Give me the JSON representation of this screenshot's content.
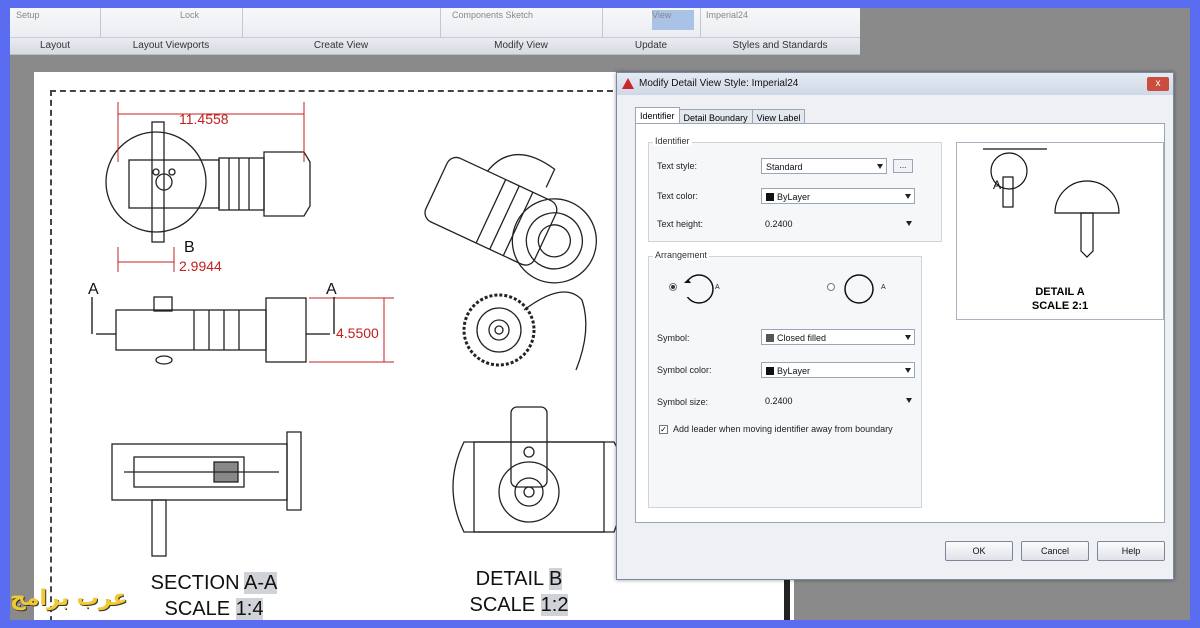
{
  "ribbon": {
    "panels": [
      {
        "label": "Layout",
        "top_text": "Setup"
      },
      {
        "label": "Layout Viewports",
        "top_text": "Lock"
      },
      {
        "label": "Create View",
        "top_text": ""
      },
      {
        "label": "Modify View",
        "top_text": "Components  Sketch"
      },
      {
        "label": "Update",
        "top_text": "View"
      },
      {
        "label": "Styles and Standards",
        "top_text": "Imperial24"
      }
    ]
  },
  "drawing": {
    "dims": {
      "top_width": "11.4558",
      "small": "2.9944",
      "height": "4.5500"
    },
    "labels": {
      "a_left": "A",
      "a_right": "A",
      "b": "B"
    },
    "section": {
      "line1_pre": "SECTION ",
      "line1_hl": "A-A",
      "line2_pre": "SCALE ",
      "line2_hl": "1:4"
    },
    "detail": {
      "line1_pre": "DETAIL ",
      "line1_hl": "B",
      "line2_pre": "SCALE ",
      "line2_hl": "1:2"
    }
  },
  "dialog": {
    "title": "Modify Detail View Style: Imperial24",
    "close": "x",
    "tabs": [
      "Identifier",
      "Detail Boundary",
      "View Label"
    ],
    "identifier_group": "Identifier",
    "text_style_label": "Text style:",
    "text_style_value": "Standard",
    "ellipsis": "...",
    "text_color_label": "Text color:",
    "text_color_value": "ByLayer",
    "text_height_label": "Text height:",
    "text_height_value": "0.2400",
    "arrangement_group": "Arrangement",
    "radio_a": "A",
    "symbol_label": "Symbol:",
    "symbol_value": "Closed filled",
    "symbol_color_label": "Symbol color:",
    "symbol_color_value": "ByLayer",
    "symbol_size_label": "Symbol size:",
    "symbol_size_value": "0.2400",
    "leader_check": "Add leader when moving identifier away from boundary",
    "preview_letter": "A",
    "preview_caption1": "DETAIL A",
    "preview_caption2": "SCALE 2:1",
    "ok": "OK",
    "cancel": "Cancel",
    "help": "Help"
  },
  "watermark": "عرب برامج"
}
